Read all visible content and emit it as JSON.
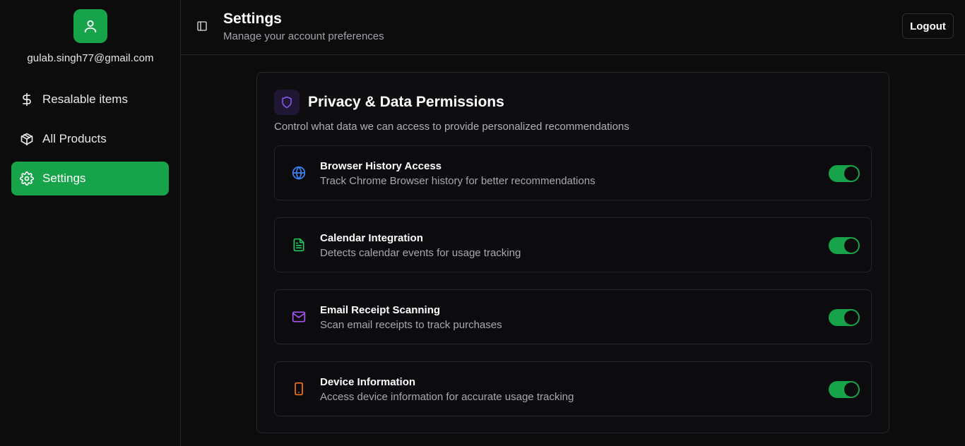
{
  "sidebar": {
    "user_email": "gulab.singh77@gmail.com",
    "items": [
      {
        "label": "Resalable items",
        "icon": "dollar-icon",
        "active": false
      },
      {
        "label": "All Products",
        "icon": "package-icon",
        "active": false
      },
      {
        "label": "Settings",
        "icon": "gear-icon",
        "active": true
      }
    ]
  },
  "header": {
    "title": "Settings",
    "subtitle": "Manage your account preferences",
    "logout_label": "Logout"
  },
  "card": {
    "title": "Privacy & Data Permissions",
    "description": "Control what data we can access to provide personalized recommendations",
    "icon": "shield-icon",
    "permissions": [
      {
        "title": "Browser History Access",
        "description": "Track Chrome Browser history for better recommendations",
        "icon": "globe-icon",
        "enabled": true
      },
      {
        "title": "Calendar Integration",
        "description": "Detects calendar events for usage tracking",
        "icon": "document-icon",
        "enabled": true
      },
      {
        "title": "Email Receipt Scanning",
        "description": "Scan email receipts to track purchases",
        "icon": "mail-icon",
        "enabled": true
      },
      {
        "title": "Device Information",
        "description": "Access device information for accurate usage tracking",
        "icon": "smartphone-icon",
        "enabled": true
      }
    ]
  },
  "colors": {
    "accent": "#16a34a",
    "shield": "#8b5cf6",
    "globe": "#3b82f6",
    "document": "#22c55e",
    "mail": "#a855f7",
    "smartphone": "#f97316"
  }
}
